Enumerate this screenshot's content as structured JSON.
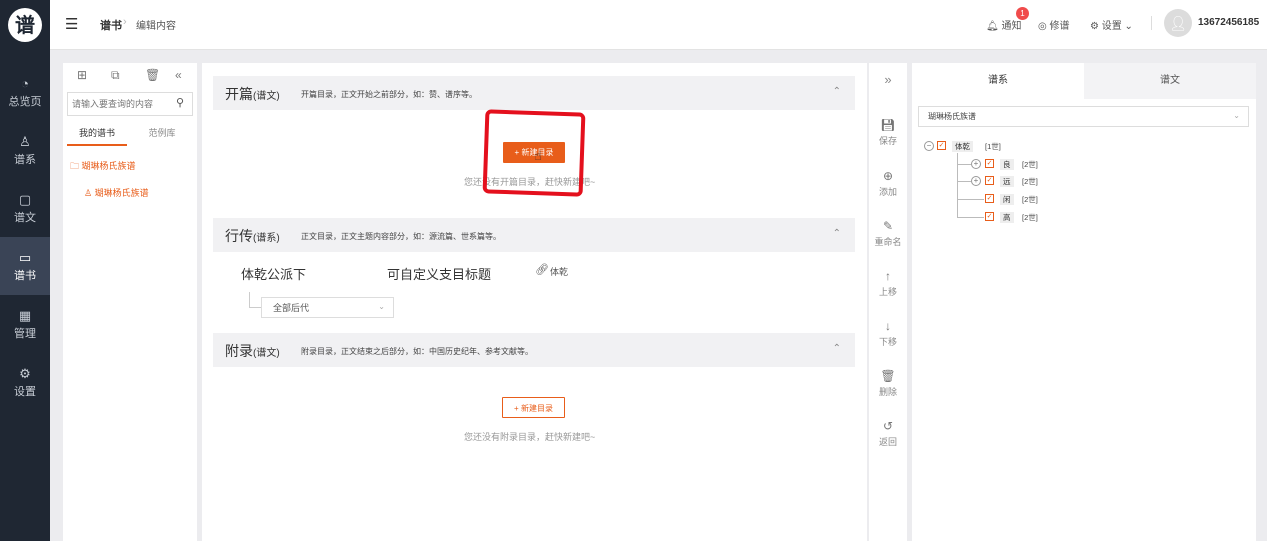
{
  "app": {
    "logo": "谱"
  },
  "nav": [
    {
      "icon": "◔",
      "label": "总览页"
    },
    {
      "icon": "♙",
      "label": "谱系"
    },
    {
      "icon": "▢",
      "label": "谱文"
    },
    {
      "icon": "▭",
      "label": "谱书"
    },
    {
      "icon": "▦",
      "label": "管理"
    },
    {
      "icon": "⚙",
      "label": "设置"
    }
  ],
  "header": {
    "breadcrumb": [
      "谱书",
      "编辑内容"
    ],
    "notify": "通知",
    "notify_count": "1",
    "xiupu": "修谱",
    "settings": "设置",
    "phone": "13672456185"
  },
  "left": {
    "search_placeholder": "请输入要查询的内容",
    "tabs": [
      "我的谱书",
      "范例库"
    ],
    "tree": [
      "瑚琳杨氏族谱",
      "瑚琳杨氏族谱"
    ]
  },
  "sections": [
    {
      "title": "开篇",
      "sub": "(谱文)",
      "desc": "开篇目录，正文开始之前部分，如：赞、谱序等。",
      "btn": "+ 新建目录",
      "empty": "您还没有开篇目录，赶快新建吧~"
    },
    {
      "title": "行传",
      "sub": "(谱系)",
      "desc": "正文目录，正文主题内容部分，如：源流篇、世系篇等。",
      "row_name": "体乾公派下",
      "row_title": "可自定义支目标题",
      "row_link": "体乾",
      "select": "全部后代"
    },
    {
      "title": "附录",
      "sub": "(谱文)",
      "desc": "附录目录，正文结束之后部分，如：中国历史纪年、参考文献等。",
      "btn": "+ 新建目录",
      "empty": "您还没有附录目录，赶快新建吧~"
    }
  ],
  "actions": [
    "保存",
    "添加",
    "重命名",
    "上移",
    "下移",
    "删除",
    "返回"
  ],
  "right": {
    "tabs": [
      "谱系",
      "谱文"
    ],
    "select": "瑚琳杨氏族谱",
    "tree": [
      {
        "name": "体乾",
        "gen": "[1世]"
      },
      {
        "name": "良",
        "gen": "[2世]"
      },
      {
        "name": "远",
        "gen": "[2世]"
      },
      {
        "name": "闲",
        "gen": "[2世]"
      },
      {
        "name": "高",
        "gen": "[2世]"
      }
    ]
  },
  "colors": {
    "accent": "#e85d1a",
    "nav_bg": "#1f2733",
    "highlight": "#e4101d"
  }
}
